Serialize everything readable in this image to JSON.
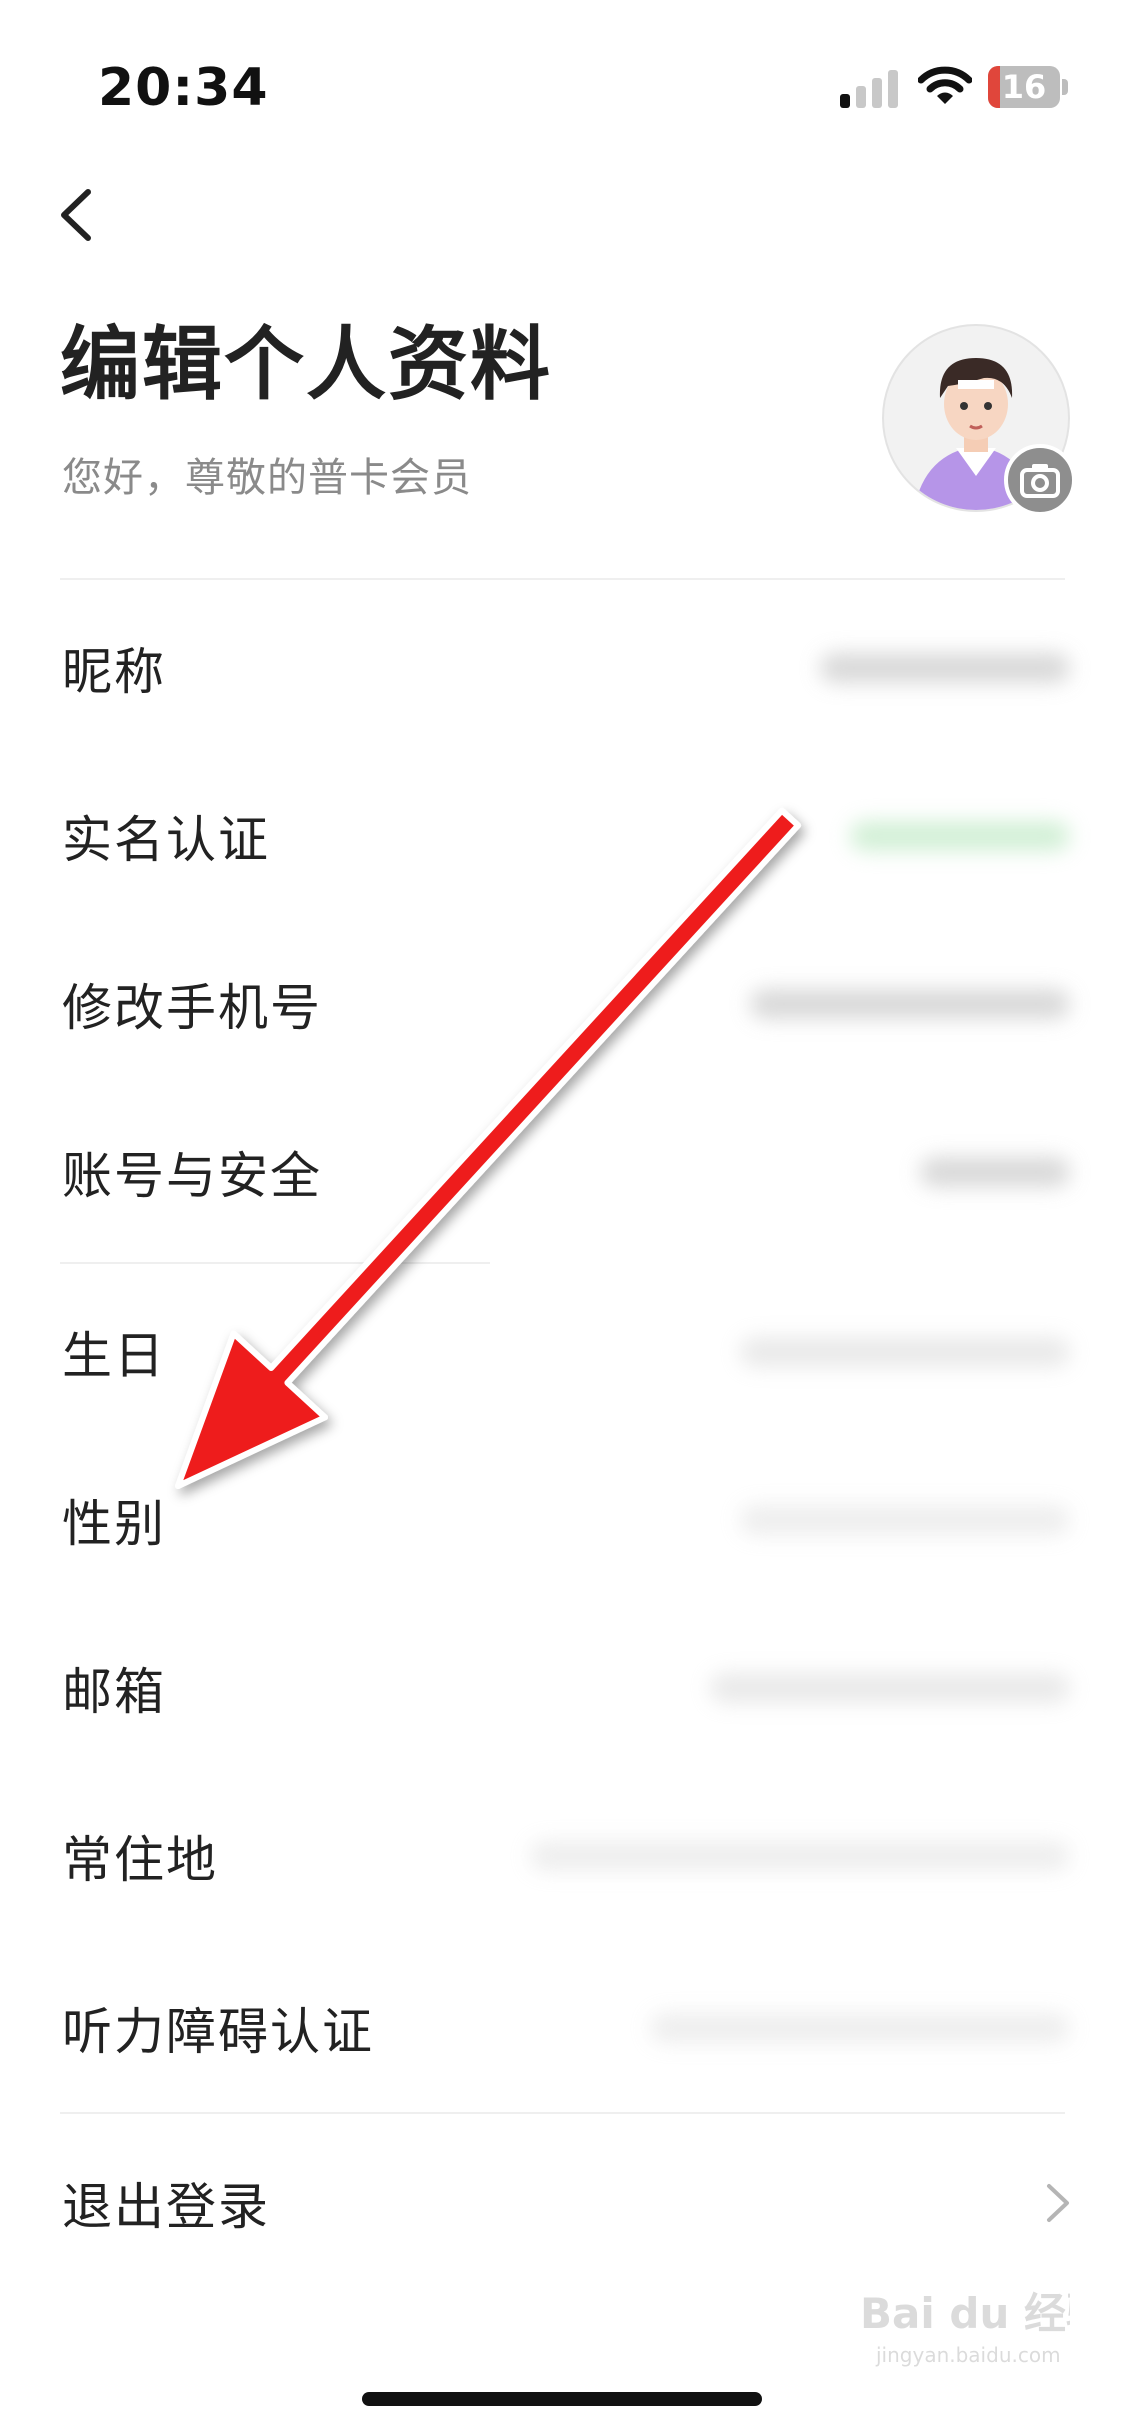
{
  "status_bar": {
    "time": "20:34",
    "battery": "16",
    "battery_level": 0.16
  },
  "header": {
    "title": "编辑个人资料",
    "subtitle": "您好，尊敬的普卡会员"
  },
  "colors": {
    "arrow": "#ee1c1c",
    "battery_low": "#e0463b",
    "value_tint_green": "#c7eccc"
  },
  "profile_items": [
    {
      "label": "昵称"
    },
    {
      "label": "实名认证"
    },
    {
      "label": "修改手机号"
    },
    {
      "label": "账号与安全"
    },
    {
      "label": "生日"
    },
    {
      "label": "性别"
    },
    {
      "label": "邮箱"
    },
    {
      "label": "常住地"
    },
    {
      "label": "听力障碍认证"
    }
  ],
  "logout": {
    "label": "退出登录"
  },
  "watermark": {
    "logo_text": "Bai du 经验",
    "url_text": "jingyan.baidu.com"
  }
}
